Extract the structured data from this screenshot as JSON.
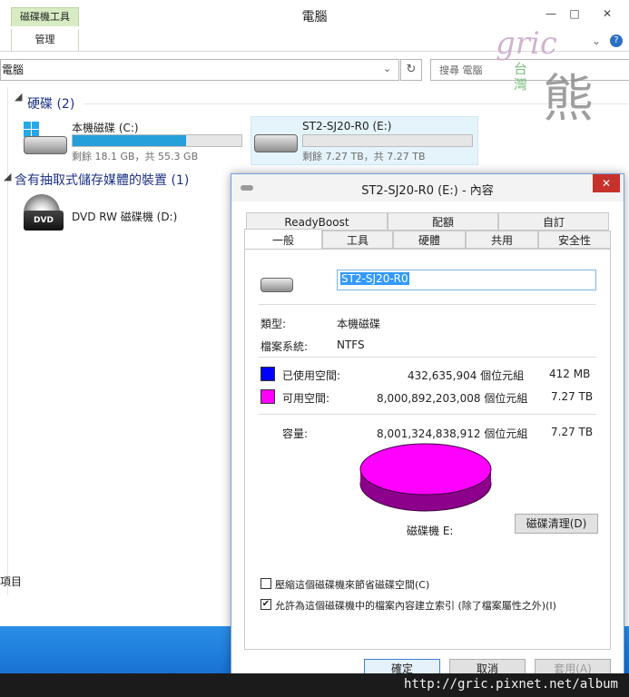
{
  "explorer": {
    "title": "電腦",
    "ribbon_tab_tools": "磁碟機工具",
    "ribbon_tab_manage": "管理",
    "address": "電腦",
    "search_placeholder": "搜尋 電腦",
    "status": "項目"
  },
  "groups": [
    {
      "title": "硬碟 (2)"
    },
    {
      "title": "含有抽取式儲存媒體的裝置 (1)"
    }
  ],
  "drives": [
    {
      "name": "本機磁碟 (C:)",
      "info": "剩餘 18.1 GB，共 55.3 GB",
      "used_fraction": 0.67
    },
    {
      "name": "ST2-SJ20-R0 (E:)",
      "info": "剩餘 7.27 TB，共 7.27 TB",
      "used_fraction": 0.0
    },
    {
      "name": "DVD RW 磁碟機 (D:)"
    }
  ],
  "dialog": {
    "title": "ST2-SJ20-R0 (E:) - 內容",
    "tabs_row1": [
      "ReadyBoost",
      "配額",
      "自訂"
    ],
    "tabs_row2": [
      "一般",
      "工具",
      "硬體",
      "共用",
      "安全性"
    ],
    "active_tab": "一般",
    "volume_name": "ST2-SJ20-R0",
    "type_label": "類型:",
    "type_value": "本機磁碟",
    "fs_label": "檔案系統:",
    "fs_value": "NTFS",
    "used_label": "已使用空間:",
    "used_bytes": "432,635,904 個位元組",
    "used_size": "412 MB",
    "free_label": "可用空間:",
    "free_bytes": "8,000,892,203,008 個位元組",
    "free_size": "7.27 TB",
    "capacity_label": "容量:",
    "capacity_bytes": "8,001,324,838,912 個位元組",
    "capacity_size": "7.27 TB",
    "drive_caption": "磁碟機 E:",
    "cleanup_button": "磁碟清理(D)",
    "compress_label": "壓縮這個磁碟機來節省磁碟空間(C)",
    "compress_checked": false,
    "index_label": "允許為這個磁碟機中的檔案內容建立索引 (除了檔案屬性之外)(I)",
    "index_checked": true,
    "ok_button": "確定",
    "cancel_button": "取消",
    "apply_button": "套用(A)",
    "used_color": "#0000ff",
    "free_color": "#ff00ff"
  },
  "watermark": {
    "gric": "gric",
    "taiwan": "台灣",
    "bear": "熊",
    "url": "http://gric.pixnet.net/album"
  }
}
